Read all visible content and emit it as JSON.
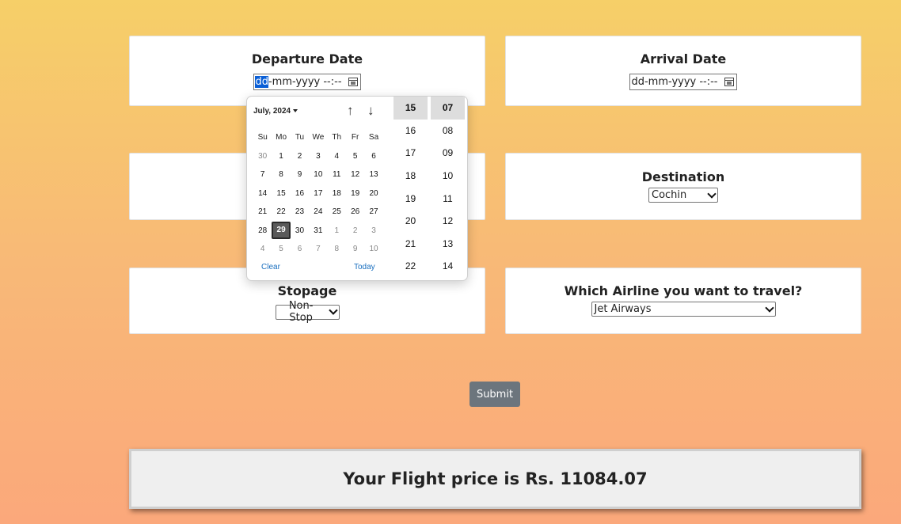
{
  "form": {
    "departure": {
      "label": "Departure Date",
      "placeholder": "dd-mm-yyyy --:--",
      "seg_dd": "dd",
      "seg_rest": "-mm-yyyy --:--"
    },
    "arrival": {
      "label": "Arrival Date",
      "placeholder": "dd-mm-yyyy --:--"
    },
    "destination": {
      "label": "Destination",
      "selected": "Cochin"
    },
    "stopage": {
      "label": "Stopage",
      "selected": "Non-Stop"
    },
    "airline": {
      "label": "Which Airline you want to travel?",
      "selected": "Jet Airways"
    },
    "submit_label": "Submit"
  },
  "result": {
    "text": "Your Flight price is Rs. 11084.07"
  },
  "picker": {
    "month_label": "July, 2024",
    "weekdays": [
      "Su",
      "Mo",
      "Tu",
      "We",
      "Th",
      "Fr",
      "Sa"
    ],
    "weeks": [
      [
        {
          "d": "30",
          "m": true
        },
        {
          "d": "1"
        },
        {
          "d": "2"
        },
        {
          "d": "3"
        },
        {
          "d": "4"
        },
        {
          "d": "5"
        },
        {
          "d": "6"
        }
      ],
      [
        {
          "d": "7"
        },
        {
          "d": "8"
        },
        {
          "d": "9"
        },
        {
          "d": "10"
        },
        {
          "d": "11"
        },
        {
          "d": "12"
        },
        {
          "d": "13"
        }
      ],
      [
        {
          "d": "14"
        },
        {
          "d": "15"
        },
        {
          "d": "16"
        },
        {
          "d": "17"
        },
        {
          "d": "18"
        },
        {
          "d": "19"
        },
        {
          "d": "20"
        }
      ],
      [
        {
          "d": "21"
        },
        {
          "d": "22"
        },
        {
          "d": "23"
        },
        {
          "d": "24"
        },
        {
          "d": "25"
        },
        {
          "d": "26"
        },
        {
          "d": "27"
        }
      ],
      [
        {
          "d": "28"
        },
        {
          "d": "29",
          "sel": true
        },
        {
          "d": "30"
        },
        {
          "d": "31"
        },
        {
          "d": "1",
          "m": true
        },
        {
          "d": "2",
          "m": true
        },
        {
          "d": "3",
          "m": true
        }
      ],
      [
        {
          "d": "4",
          "m": true
        },
        {
          "d": "5",
          "m": true
        },
        {
          "d": "6",
          "m": true
        },
        {
          "d": "7",
          "m": true
        },
        {
          "d": "8",
          "m": true
        },
        {
          "d": "9",
          "m": true
        },
        {
          "d": "10",
          "m": true
        }
      ]
    ],
    "clear_label": "Clear",
    "today_label": "Today",
    "hours": [
      "15",
      "16",
      "17",
      "18",
      "19",
      "20",
      "21",
      "22"
    ],
    "minutes": [
      "07",
      "08",
      "09",
      "10",
      "11",
      "12",
      "13",
      "14"
    ],
    "selected_hour": "15",
    "selected_minute": "07",
    "icons": {
      "prev": "arrow-up-icon",
      "next": "arrow-down-icon"
    }
  }
}
